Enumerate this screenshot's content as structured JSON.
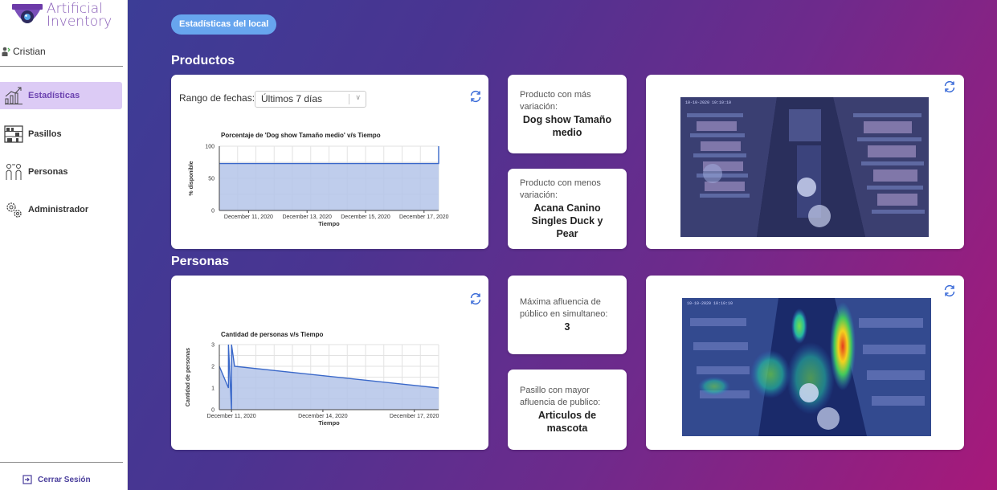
{
  "app": {
    "logo_line1": "Artificial",
    "logo_line2": "Inventory",
    "user_name": "Cristian"
  },
  "nav": [
    {
      "label": "Estadísticas",
      "icon": "bar-chart-icon",
      "active": true
    },
    {
      "label": "Pasillos",
      "icon": "shelves-icon",
      "active": false
    },
    {
      "label": "Personas",
      "icon": "people-icon",
      "active": false
    },
    {
      "label": "Administrador",
      "icon": "gears-icon",
      "active": false
    }
  ],
  "logout_label": "Cerrar Sesión",
  "page_pill": "Estadísticas del local",
  "products": {
    "section_title": "Productos",
    "range_label": "Rango de fechas:",
    "range_value": "Últimos 7 días",
    "most_variation_title": "Producto con más variación:",
    "most_variation_value": "Dog show Tamaño medio",
    "least_variation_title": "Producto con menos variación:",
    "least_variation_value": "Acana Canino Singles Duck y Pear"
  },
  "people": {
    "section_title": "Personas",
    "max_flow_title": "Máxima afluencia de público en simultaneo:",
    "max_flow_value": "3",
    "aisle_title": "Pasillo con mayor afluencia de publico:",
    "aisle_value": "Articulos de mascota"
  },
  "colors": {
    "accent": "#6c43b0",
    "pill": "#67a5ee",
    "chart_fill": "#b4c4e9",
    "chart_line": "#3a68c9"
  },
  "chart_data": [
    {
      "type": "area",
      "title": "Porcentaje de 'Dog show Tamaño medio' v/s Tiempo",
      "xlabel": "Tiempo",
      "ylabel": "% disponible",
      "ylim": [
        0,
        100
      ],
      "yticks": [
        "0",
        "50",
        "100"
      ],
      "xticks": [
        "December 11, 2020",
        "December 13, 2020",
        "December 15, 2020",
        "December 17, 2020"
      ],
      "x": [
        "2020-12-10",
        "2020-12-17.5",
        "2020-12-17.5"
      ],
      "values": [
        73,
        73,
        100
      ],
      "grid": true
    },
    {
      "type": "area",
      "title": "Cantidad de personas v/s Tiempo",
      "xlabel": "Tiempo",
      "ylabel": "Cantidad de personas",
      "ylim": [
        0,
        3
      ],
      "yticks": [
        "0",
        "1",
        "2",
        "3"
      ],
      "xticks": [
        "December 11, 2020",
        "December 14, 2020",
        "December 17, 2020"
      ],
      "x": [
        "2020-12-10.6",
        "2020-12-10.9",
        "2020-12-10.9",
        "2020-12-11",
        "2020-12-11",
        "2020-12-11.1",
        "2020-12-17.8"
      ],
      "values": [
        2,
        1,
        3,
        0,
        3,
        2,
        1
      ],
      "grid": true
    }
  ]
}
